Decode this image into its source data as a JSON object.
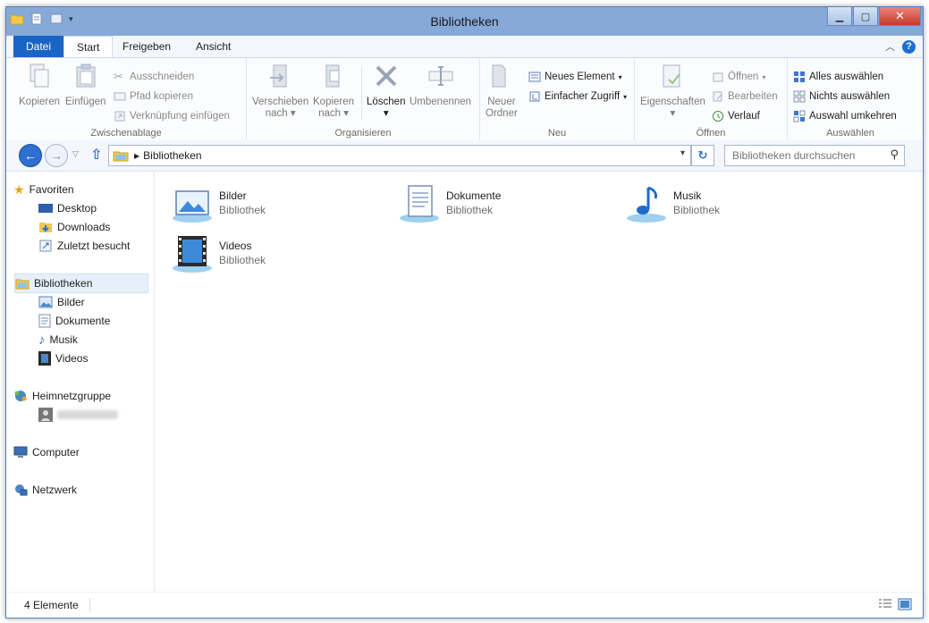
{
  "window": {
    "title": "Bibliotheken"
  },
  "tabs": [
    {
      "label": "Datei"
    },
    {
      "label": "Start"
    },
    {
      "label": "Freigeben"
    },
    {
      "label": "Ansicht"
    }
  ],
  "ribbon": {
    "zwischenablage": {
      "label": "Zwischenablage",
      "kopieren": "Kopieren",
      "einfuegen": "Einfügen",
      "ausschneiden": "Ausschneiden",
      "pfad_kopieren": "Pfad kopieren",
      "verknuepfung": "Verknüpfung einfügen"
    },
    "organisieren": {
      "label": "Organisieren",
      "verschieben_1": "Verschieben",
      "verschieben_2": "nach",
      "kopieren_1": "Kopieren",
      "kopieren_2": "nach",
      "loeschen": "Löschen",
      "umbenennen": "Umbenennen"
    },
    "neu": {
      "label": "Neu",
      "ordner_1": "Neuer",
      "ordner_2": "Ordner",
      "neues_element": "Neues Element",
      "einfacher_zugriff": "Einfacher Zugriff"
    },
    "oeffnen": {
      "label": "Öffnen",
      "eigenschaften": "Eigenschaften",
      "oeffnen": "Öffnen",
      "bearbeiten": "Bearbeiten",
      "verlauf": "Verlauf"
    },
    "auswaehlen": {
      "label": "Auswählen",
      "alles": "Alles auswählen",
      "nichts": "Nichts auswählen",
      "umkehren": "Auswahl umkehren"
    }
  },
  "address": {
    "path": "Bibliotheken",
    "search_placeholder": "Bibliotheken durchsuchen"
  },
  "navpane": {
    "favoriten": "Favoriten",
    "desktop": "Desktop",
    "downloads": "Downloads",
    "zuletzt": "Zuletzt besucht",
    "bibliotheken": "Bibliotheken",
    "bilder": "Bilder",
    "dokumente": "Dokumente",
    "musik": "Musik",
    "videos": "Videos",
    "heimnetzgruppe": "Heimnetzgruppe",
    "computer": "Computer",
    "netzwerk": "Netzwerk"
  },
  "libraries": [
    {
      "name": "Bilder",
      "type": "Bibliothek",
      "icon": "pictures-library-icon"
    },
    {
      "name": "Dokumente",
      "type": "Bibliothek",
      "icon": "documents-library-icon"
    },
    {
      "name": "Musik",
      "type": "Bibliothek",
      "icon": "music-library-icon"
    },
    {
      "name": "Videos",
      "type": "Bibliothek",
      "icon": "videos-library-icon"
    }
  ],
  "status": {
    "count": "4 Elemente"
  }
}
